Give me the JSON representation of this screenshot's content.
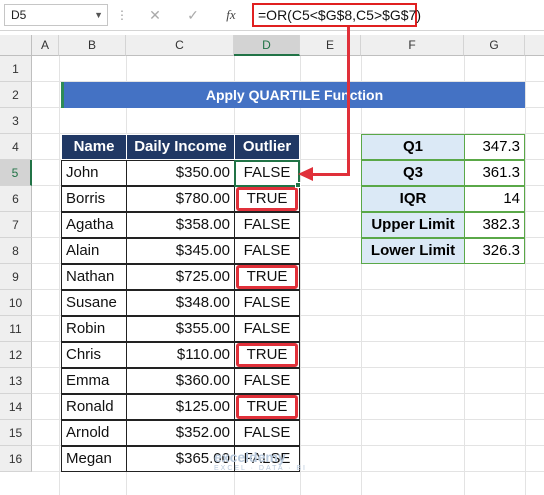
{
  "formula_bar": {
    "name_box": "D5",
    "cancel_icon": "✕",
    "enter_icon": "✓",
    "fx_label": "fx",
    "formula": "=OR(C5<$G$8,C5>$G$7)"
  },
  "column_headers": [
    "A",
    "B",
    "C",
    "D",
    "E",
    "F",
    "G"
  ],
  "row_headers": [
    "1",
    "2",
    "3",
    "4",
    "5",
    "6",
    "7",
    "8",
    "9",
    "10",
    "11",
    "12",
    "13",
    "14",
    "15",
    "16"
  ],
  "selected_cell": {
    "column": "D",
    "row": "5"
  },
  "banner_title": "Apply QUARTILE Function",
  "main_table": {
    "headers": [
      "Name",
      "Daily Income",
      "Outlier"
    ],
    "rows": [
      {
        "name": "John",
        "income": "$350.00",
        "outlier": "FALSE"
      },
      {
        "name": "Borris",
        "income": "$780.00",
        "outlier": "TRUE"
      },
      {
        "name": "Agatha",
        "income": "$358.00",
        "outlier": "FALSE"
      },
      {
        "name": "Alain",
        "income": "$345.00",
        "outlier": "FALSE"
      },
      {
        "name": "Nathan",
        "income": "$725.00",
        "outlier": "TRUE"
      },
      {
        "name": "Susane",
        "income": "$348.00",
        "outlier": "FALSE"
      },
      {
        "name": "Robin",
        "income": "$355.00",
        "outlier": "FALSE"
      },
      {
        "name": "Chris",
        "income": "$110.00",
        "outlier": "TRUE"
      },
      {
        "name": "Emma",
        "income": "$360.00",
        "outlier": "FALSE"
      },
      {
        "name": "Ronald",
        "income": "$125.00",
        "outlier": "TRUE"
      },
      {
        "name": "Arnold",
        "income": "$352.00",
        "outlier": "FALSE"
      },
      {
        "name": "Megan",
        "income": "$365.00",
        "outlier": "FALSE"
      }
    ]
  },
  "quartile_table": {
    "rows": [
      {
        "label": "Q1",
        "value": "347.3"
      },
      {
        "label": "Q3",
        "value": "361.3"
      },
      {
        "label": "IQR",
        "value": "14"
      },
      {
        "label": "Upper Limit",
        "value": "382.3"
      },
      {
        "label": "Lower Limit",
        "value": "326.3"
      }
    ]
  },
  "watermark": {
    "brand": "exceldemy",
    "tagline": "EXCEL · DATA · BI"
  },
  "colors": {
    "header_fill": "#203864",
    "banner_fill": "#4472c4",
    "quartile_label_fill": "#dbe9f6",
    "highlight": "#e0303a",
    "selection": "#217346"
  }
}
